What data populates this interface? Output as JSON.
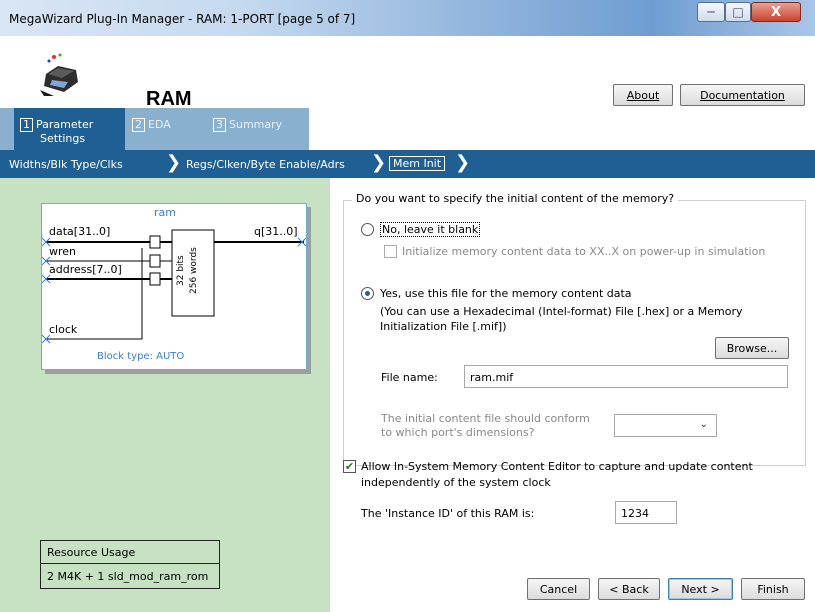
{
  "window": {
    "title": "MegaWizard Plug-In Manager - RAM: 1-PORT [page 5 of 7]",
    "controls": {
      "minimize": "─",
      "maximize": "□",
      "close": "X"
    }
  },
  "header": {
    "app_title": "RAM",
    "about_label": "About",
    "documentation_label": "Documentation"
  },
  "steps": [
    {
      "num": "1",
      "label_line1": "Parameter",
      "label_line2": "Settings"
    },
    {
      "num": "2",
      "label": "EDA"
    },
    {
      "num": "3",
      "label": "Summary"
    }
  ],
  "subnav": {
    "items": [
      "Widths/Blk Type/Clks",
      "Regs/Clken/Byte Enable/Adrs",
      "Mem Init"
    ],
    "chevron": "❯"
  },
  "diagram": {
    "title": "ram",
    "ports_in": [
      "data[31..0]",
      "wren",
      "address[7..0]",
      "clock"
    ],
    "port_out": "q[31..0]",
    "mem_label_1": "32 bits",
    "mem_label_2": "256 words",
    "block_type": "Block type: AUTO"
  },
  "resource_usage": {
    "header": "Resource Usage",
    "value": "2 M4K + 1 sld_mod_ram_rom"
  },
  "memory_init": {
    "question": "Do you want to specify the initial content of the memory?",
    "option_no": "No, leave it blank",
    "init_xx_label": "Initialize memory content data to XX..X on power-up in simulation",
    "option_yes": "Yes, use this file for the memory content data",
    "yes_note_line1": "(You can use a Hexadecimal (Intel-format) File [.hex] or a Memory",
    "yes_note_line2": "Initialization File [.mif])",
    "browse_label": "Browse...",
    "file_name_label": "File name:",
    "file_name_value": "ram.mif",
    "conform_line1": "The initial content file should conform",
    "conform_line2": "to which port's dimensions?",
    "conform_value": "",
    "selected_option": "yes"
  },
  "in_system": {
    "label_line1": "Allow In-System Memory Content Editor to capture and update content",
    "label_line2": "independently of the system clock",
    "checked": true,
    "instance_label": "The 'Instance ID' of this RAM is:",
    "instance_value": "1234"
  },
  "footer": {
    "cancel": "Cancel",
    "back": "< Back",
    "next": "Next >",
    "finish": "Finish"
  },
  "colors": {
    "step_active": "#1f5f94",
    "step_inactive": "#8ab0cf",
    "left_panel": "#c7e1c3"
  }
}
